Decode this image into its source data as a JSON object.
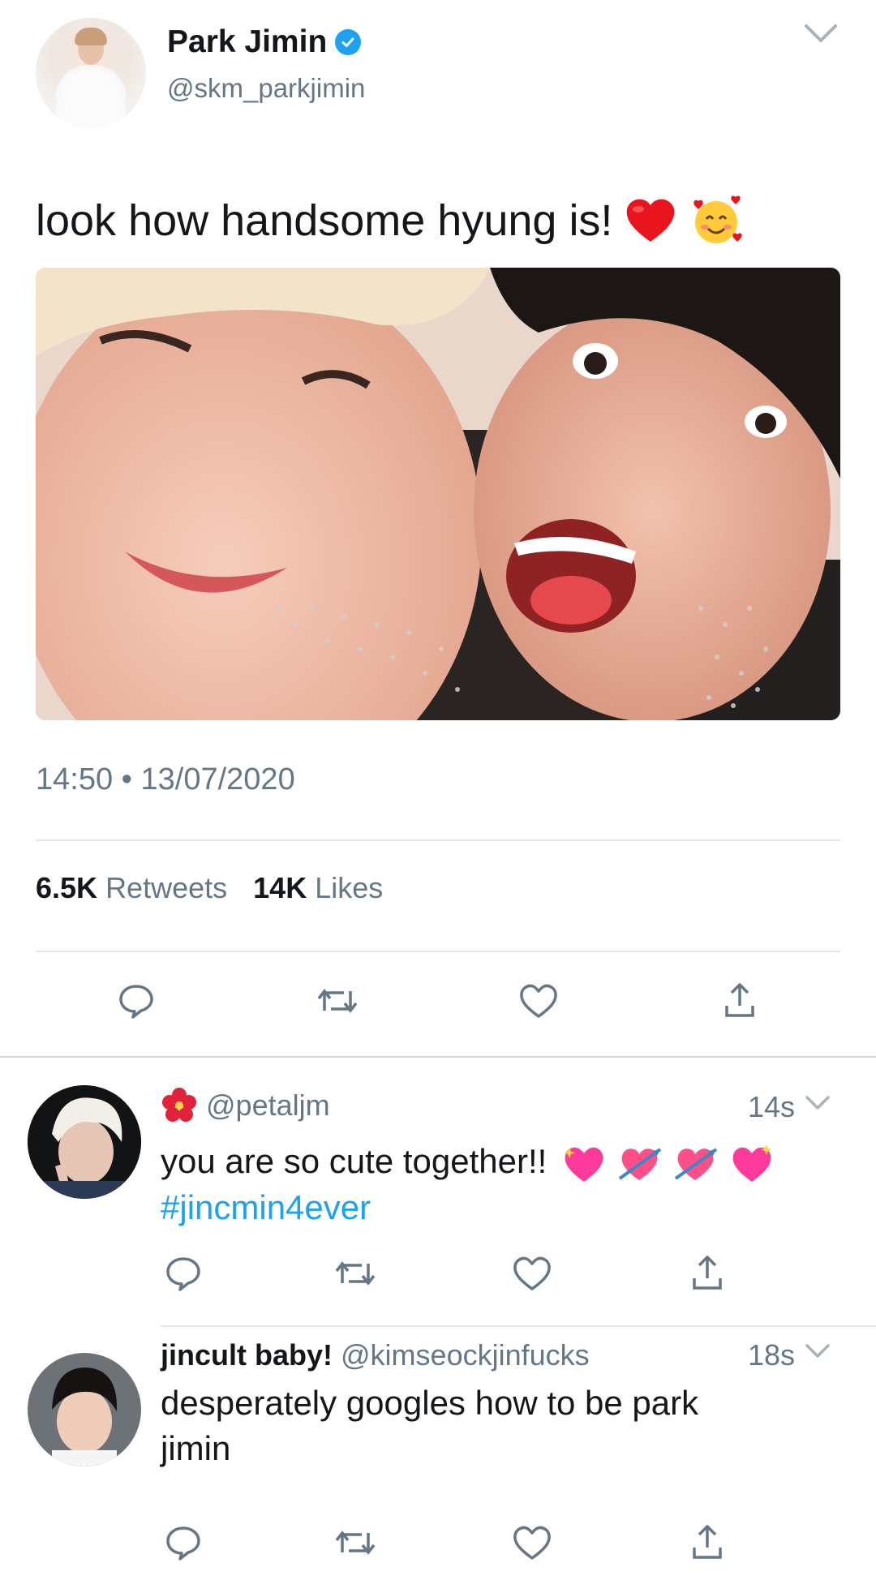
{
  "main_tweet": {
    "display_name": "Park Jimin",
    "handle": "@skm_parkjimin",
    "text": "look how handsome hyung is!",
    "emojis": [
      "red-heart",
      "smiling-face-with-hearts"
    ],
    "timestamp": "14:50 • 13/07/2020",
    "retweets_count": "6.5K",
    "retweets_label": "Retweets",
    "likes_count": "14K",
    "likes_label": "Likes"
  },
  "replies": [
    {
      "name": "",
      "name_emoji": "hibiscus",
      "handle": "@petaljm",
      "time": "14s",
      "text": "you are so cute together!!",
      "emojis": [
        "sparkling-heart",
        "heart-with-arrow",
        "heart-with-arrow",
        "sparkling-heart"
      ],
      "hashtag": "#jincmin4ever"
    },
    {
      "name": "jincult baby!",
      "handle": "@kimseockjinfucks",
      "time": "18s",
      "text": "desperately googles how to be park jimin"
    }
  ],
  "icons": [
    "verified-badge",
    "chevron-down",
    "reply",
    "retweet",
    "like",
    "share"
  ],
  "colors": {
    "accent": "#1da1f2",
    "text_primary": "#14171a",
    "text_secondary": "#657786",
    "divider": "#e1e8ed"
  }
}
